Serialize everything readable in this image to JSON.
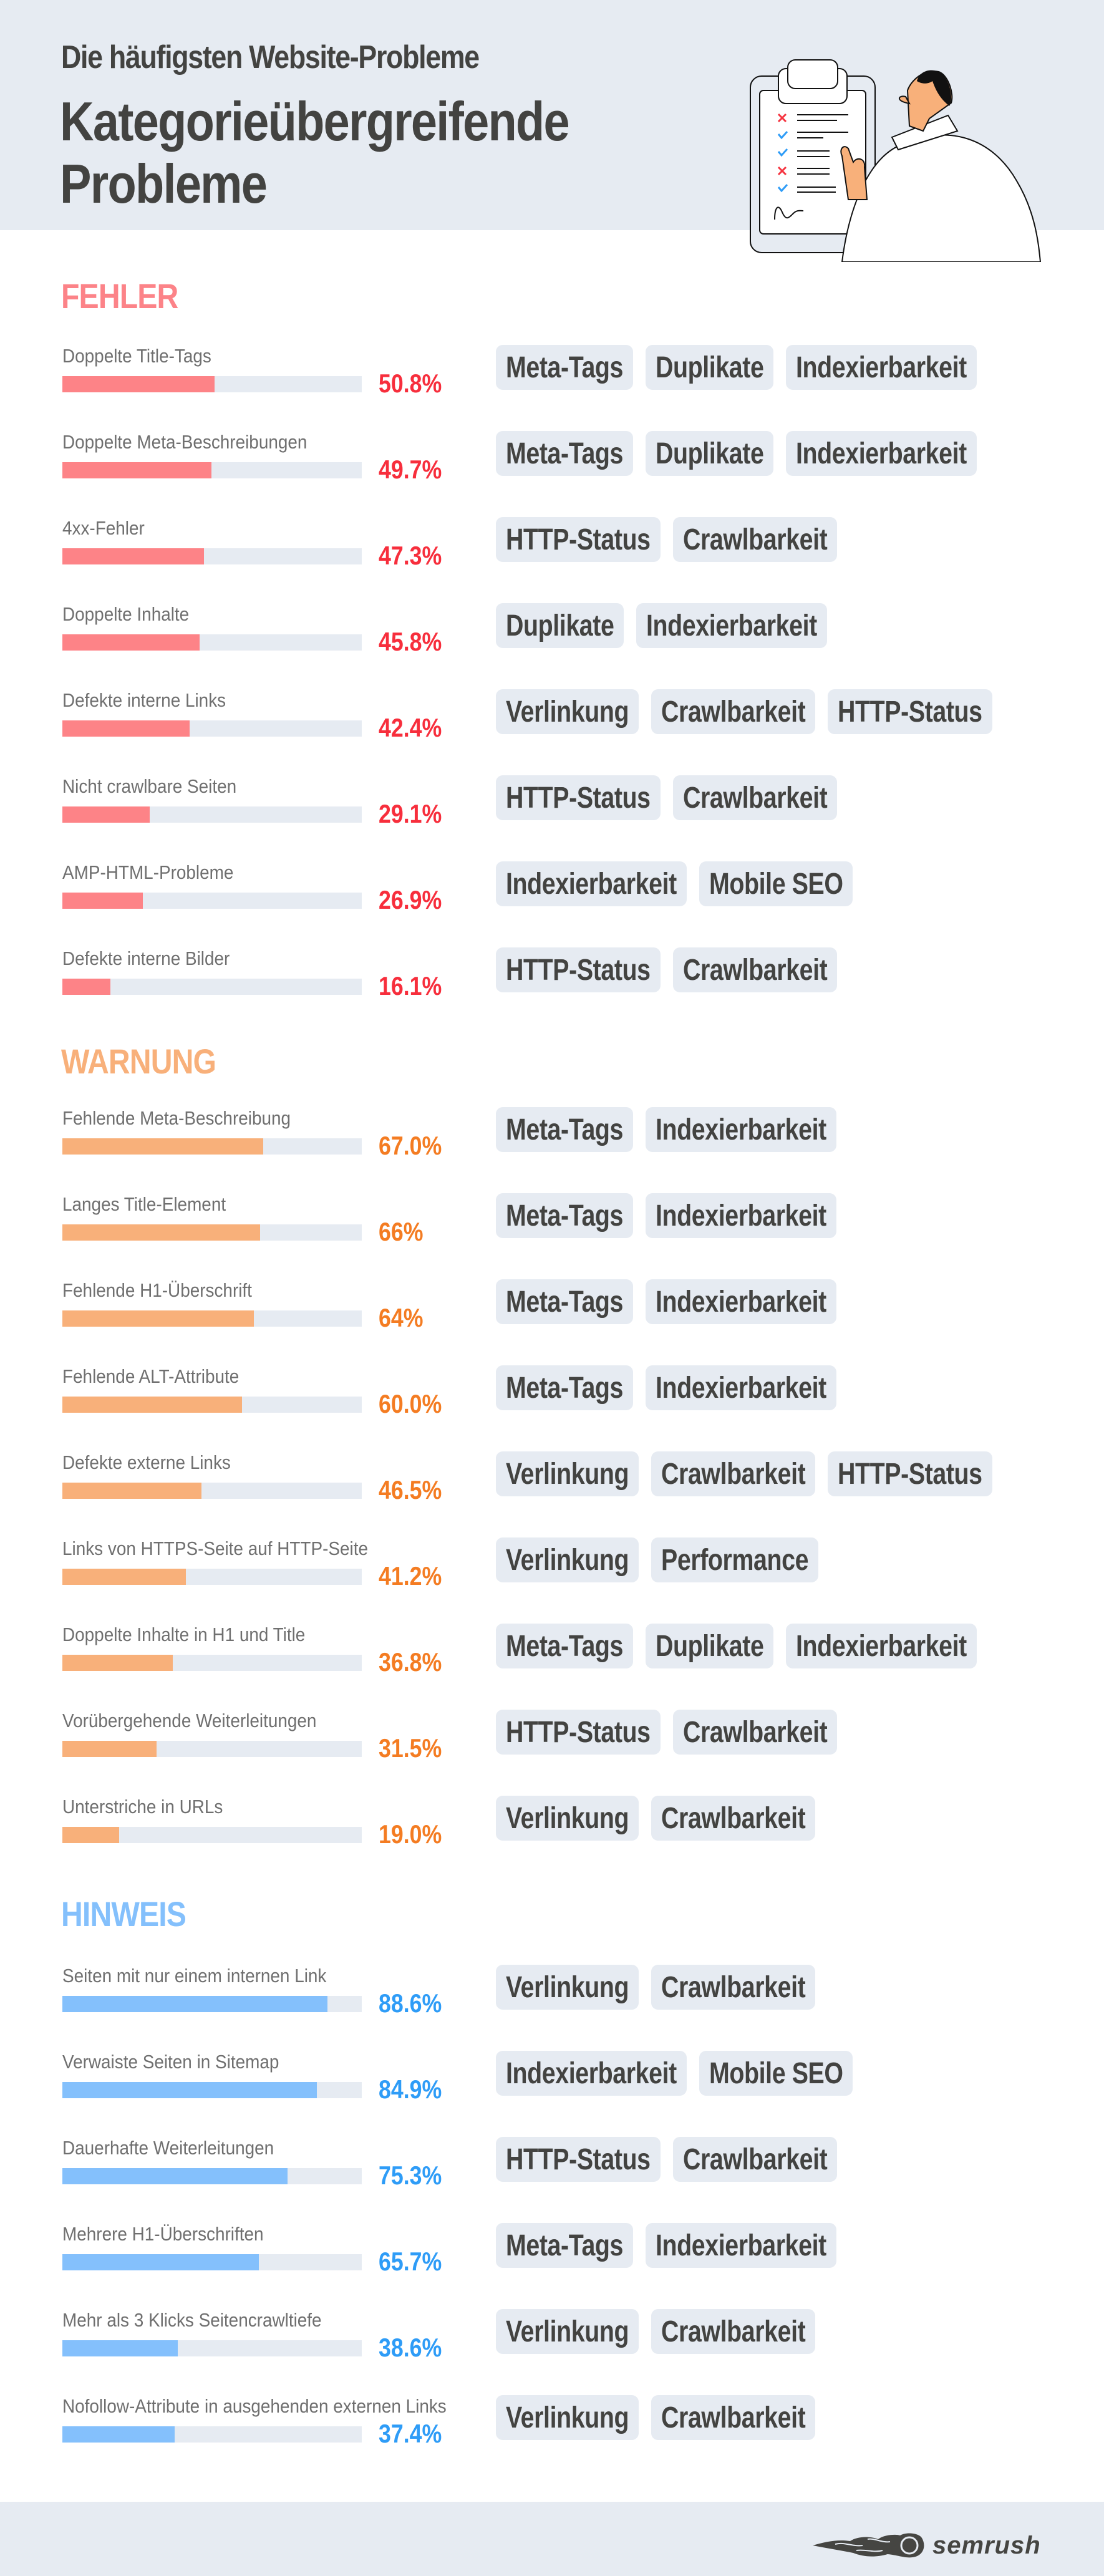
{
  "header": {
    "subtitle": "Die häufigsten Website-Probleme",
    "title_line1": "Kategorieübergreifende",
    "title_line2": "Probleme",
    "illustration": "person-pointing-at-checklist-clipboard"
  },
  "colors": {
    "background_light": "#e6ebf2",
    "text_dark": "#434341",
    "label_gray": "#6f6f6f",
    "fehler_heading": "#fc8388",
    "fehler_bar": "#fd8387",
    "fehler_value": "#f72e3c",
    "warnung_heading": "#f8b07a",
    "warnung_bar": "#f8b07a",
    "warnung_value": "#f47c22",
    "hinweis_heading": "#84c0fc",
    "hinweis_bar": "#84c0fc",
    "hinweis_value": "#2e9cf7"
  },
  "footer": {
    "brand": "semrush",
    "logo_icon": "semrush-fireball-logo"
  },
  "chart_data": {
    "type": "bar",
    "orientation": "horizontal",
    "title": "Kategorieübergreifende Probleme",
    "subtitle": "Die häufigsten Website-Probleme",
    "unit": "%",
    "xlim": [
      0,
      100
    ],
    "groups": [
      {
        "name": "FEHLER",
        "key": "fehler",
        "items": [
          {
            "label": "Doppelte Title-Tags",
            "value": 50.8,
            "value_text": "50.8%",
            "tags": [
              "Meta-Tags",
              "Duplikate",
              "Indexierbarkeit"
            ]
          },
          {
            "label": "Doppelte Meta-Beschreibungen",
            "value": 49.7,
            "value_text": "49.7%",
            "tags": [
              "Meta-Tags",
              "Duplikate",
              "Indexierbarkeit"
            ]
          },
          {
            "label": "4xx-Fehler",
            "value": 47.3,
            "value_text": "47.3%",
            "tags": [
              "HTTP-Status",
              "Crawlbarkeit"
            ]
          },
          {
            "label": "Doppelte Inhalte",
            "value": 45.8,
            "value_text": "45.8%",
            "tags": [
              "Duplikate",
              "Indexierbarkeit"
            ]
          },
          {
            "label": "Defekte interne Links",
            "value": 42.4,
            "value_text": "42.4%",
            "tags": [
              "Verlinkung",
              "Crawlbarkeit",
              "HTTP-Status"
            ]
          },
          {
            "label": "Nicht crawlbare Seiten",
            "value": 29.1,
            "value_text": "29.1%",
            "tags": [
              "HTTP-Status",
              "Crawlbarkeit"
            ]
          },
          {
            "label": "AMP-HTML-Probleme",
            "value": 26.9,
            "value_text": "26.9%",
            "tags": [
              "Indexierbarkeit",
              "Mobile SEO"
            ]
          },
          {
            "label": "Defekte interne Bilder",
            "value": 16.1,
            "value_text": "16.1%",
            "tags": [
              "HTTP-Status",
              "Crawlbarkeit"
            ]
          }
        ]
      },
      {
        "name": "WARNUNG",
        "key": "warnung",
        "items": [
          {
            "label": "Fehlende Meta-Beschreibung",
            "value": 67.0,
            "value_text": "67.0%",
            "tags": [
              "Meta-Tags",
              "Indexierbarkeit"
            ]
          },
          {
            "label": "Langes Title-Element",
            "value": 66,
            "value_text": "66%",
            "tags": [
              "Meta-Tags",
              "Indexierbarkeit"
            ]
          },
          {
            "label": "Fehlende H1-Überschrift",
            "value": 64,
            "value_text": "64%",
            "tags": [
              "Meta-Tags",
              "Indexierbarkeit"
            ]
          },
          {
            "label": "Fehlende ALT-Attribute",
            "value": 60.0,
            "value_text": "60.0%",
            "tags": [
              "Meta-Tags",
              "Indexierbarkeit"
            ]
          },
          {
            "label": "Defekte externe Links",
            "value": 46.5,
            "value_text": "46.5%",
            "tags": [
              "Verlinkung",
              "Crawlbarkeit",
              "HTTP-Status"
            ]
          },
          {
            "label": "Links von HTTPS-Seite auf HTTP-Seite",
            "value": 41.2,
            "value_text": "41.2%",
            "tags": [
              "Verlinkung",
              "Performance"
            ]
          },
          {
            "label": "Doppelte Inhalte in H1 und Title",
            "value": 36.8,
            "value_text": "36.8%",
            "tags": [
              "Meta-Tags",
              "Duplikate",
              "Indexierbarkeit"
            ]
          },
          {
            "label": "Vorübergehende Weiterleitungen",
            "value": 31.5,
            "value_text": "31.5%",
            "tags": [
              "HTTP-Status",
              "Crawlbarkeit"
            ]
          },
          {
            "label": "Unterstriche in URLs",
            "value": 19.0,
            "value_text": "19.0%",
            "tags": [
              "Verlinkung",
              "Crawlbarkeit"
            ]
          }
        ]
      },
      {
        "name": "HINWEIS",
        "key": "hinweis",
        "items": [
          {
            "label": "Seiten mit nur einem internen Link",
            "value": 88.6,
            "value_text": "88.6%",
            "tags": [
              "Verlinkung",
              "Crawlbarkeit"
            ]
          },
          {
            "label": "Verwaiste Seiten in Sitemap",
            "value": 84.9,
            "value_text": "84.9%",
            "tags": [
              "Indexierbarkeit",
              "Mobile SEO"
            ]
          },
          {
            "label": "Dauerhafte Weiterleitungen",
            "value": 75.3,
            "value_text": "75.3%",
            "tags": [
              "HTTP-Status",
              "Crawlbarkeit"
            ]
          },
          {
            "label": "Mehrere H1-Überschriften",
            "value": 65.7,
            "value_text": "65.7%",
            "tags": [
              "Meta-Tags",
              "Indexierbarkeit"
            ]
          },
          {
            "label": "Mehr als 3 Klicks Seitencrawltiefe",
            "value": 38.6,
            "value_text": "38.6%",
            "tags": [
              "Verlinkung",
              "Crawlbarkeit"
            ]
          },
          {
            "label": "Nofollow-Attribute in ausgehenden externen Links",
            "value": 37.4,
            "value_text": "37.4%",
            "tags": [
              "Verlinkung",
              "Crawlbarkeit"
            ]
          }
        ]
      }
    ]
  }
}
